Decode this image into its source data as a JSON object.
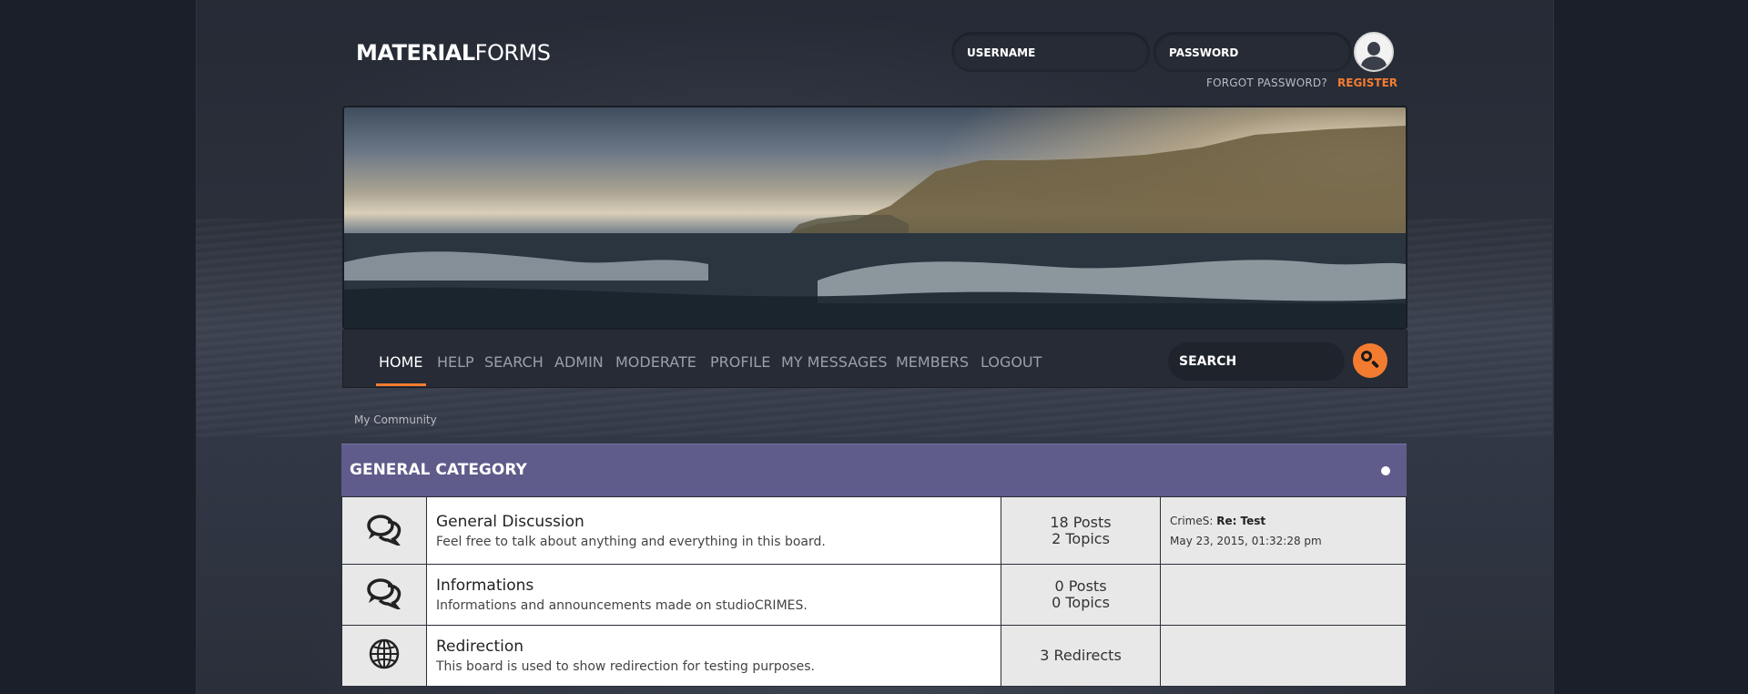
{
  "logo": {
    "bold": "MATERIAL",
    "thin": "FORMS"
  },
  "login": {
    "username_placeholder": "USERNAME",
    "password_placeholder": "PASSWORD",
    "forgot_label": "FORGOT PASSWORD?",
    "register_label": "REGISTER"
  },
  "nav": {
    "items": [
      {
        "label": "HOME",
        "active": true
      },
      {
        "label": "HELP"
      },
      {
        "label": "SEARCH"
      },
      {
        "label": "ADMIN"
      },
      {
        "label": "MODERATE"
      },
      {
        "label": "PROFILE"
      },
      {
        "label": "MY MESSAGES"
      },
      {
        "label": "MEMBERS"
      },
      {
        "label": "LOGOUT"
      }
    ],
    "search_placeholder": "SEARCH"
  },
  "breadcrumb": "My Community",
  "category": {
    "title": "GENERAL CATEGORY",
    "boards": [
      {
        "icon": "chat-bubbles-icon",
        "name": "General Discussion",
        "description": "Feel free to talk about anything and everything in this board.",
        "posts": "18 Posts",
        "topics": "2 Topics",
        "last_post_user": "CrimeS",
        "last_post_title": "Re: Test",
        "last_post_date": "May 23, 2015, 01:32:28 pm"
      },
      {
        "icon": "chat-bubbles-icon",
        "name": "Informations",
        "description": "Informations and announcements made on studioCRIMES.",
        "posts": "0 Posts",
        "topics": "0 Topics"
      },
      {
        "icon": "globe-icon",
        "name": "Redirection",
        "description": "This board is used to show redirection for testing purposes.",
        "redirects": "3 Redirects"
      }
    ]
  },
  "colors": {
    "accent": "#f47c30",
    "category_header": "#5f5b8a",
    "navbar": "#262b35",
    "page_bg": "#1b1f29"
  }
}
